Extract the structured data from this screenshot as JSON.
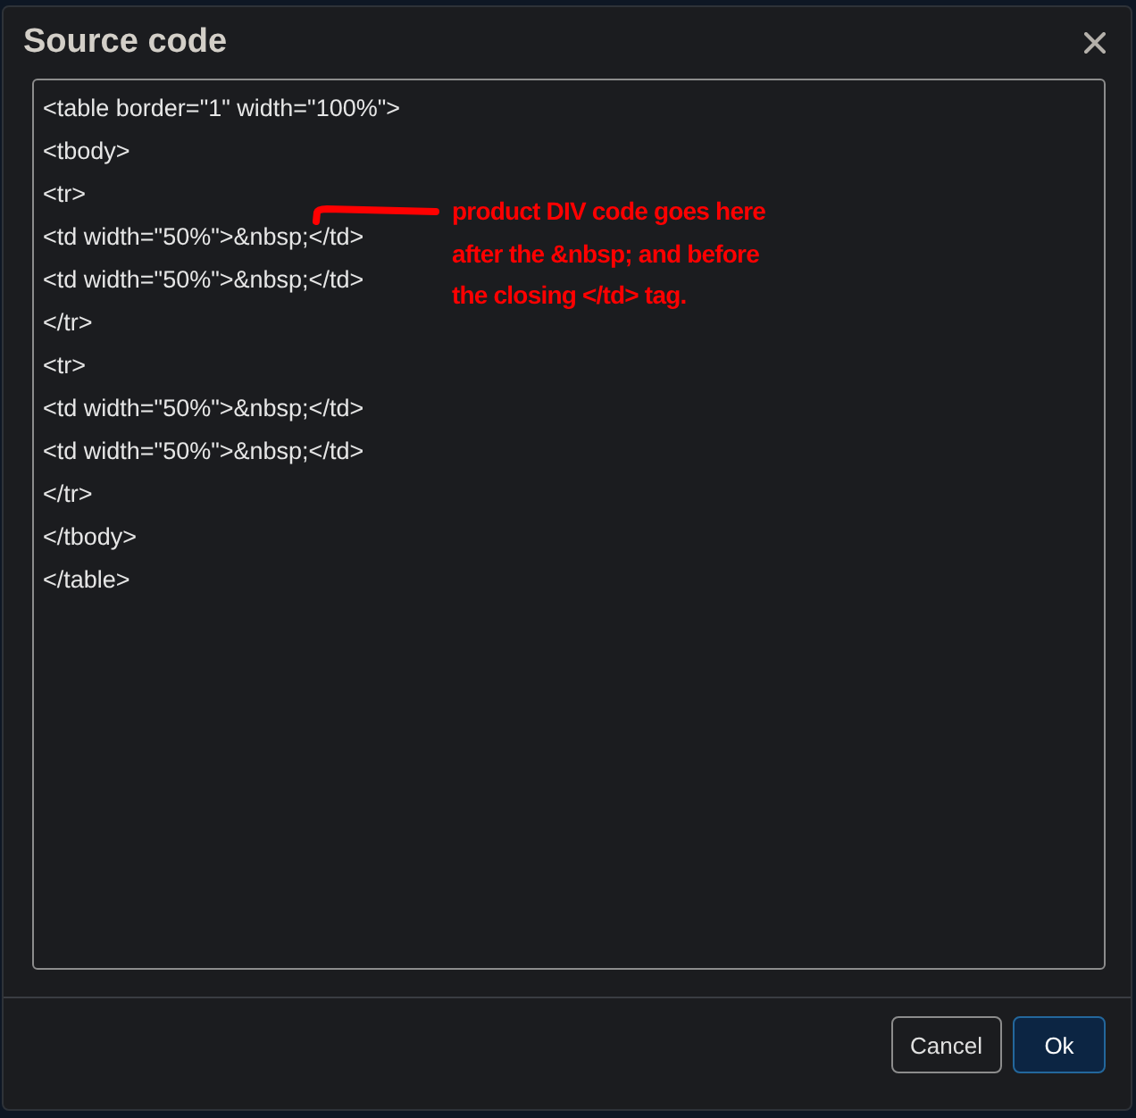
{
  "dialog": {
    "title": "Source code"
  },
  "code_lines": [
    "<table border=\"1\" width=\"100%\">",
    "<tbody>",
    "<tr>",
    "<td width=\"50%\">&nbsp;</td>",
    "<td width=\"50%\">&nbsp;</td>",
    "</tr>",
    "<tr>",
    "<td width=\"50%\">&nbsp;</td>",
    "<td width=\"50%\">&nbsp;</td>",
    "</tr>",
    "</tbody>",
    "</table>"
  ],
  "annotation": {
    "lines": [
      "product DIV code goes here",
      "after the &nbsp; and before",
      "the closing </td> tag."
    ]
  },
  "buttons": [
    {
      "label": "Cancel",
      "kind": "secondary"
    },
    {
      "label": "Ok",
      "kind": "primary"
    }
  ]
}
